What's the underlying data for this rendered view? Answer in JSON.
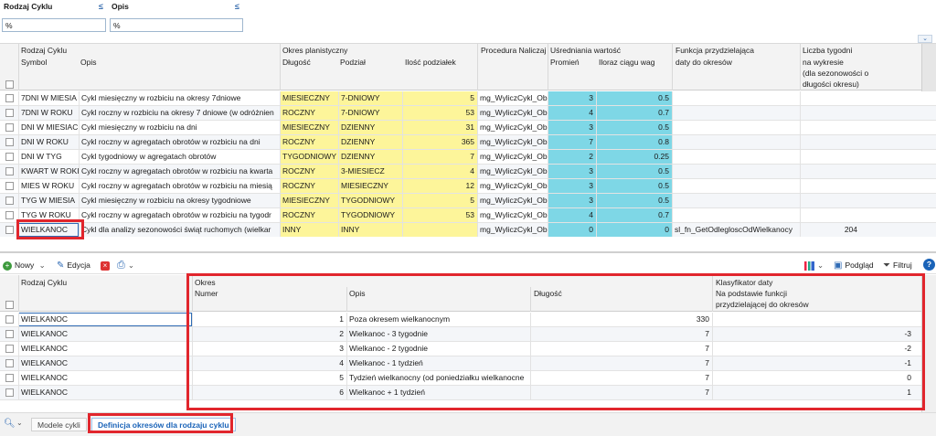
{
  "filters": {
    "rodzaj_label": "Rodzaj Cyklu",
    "opis_label": "Opis",
    "rodzaj_value": "%",
    "opis_value": "%"
  },
  "top_grid": {
    "group_headers": {
      "rodzaj": "Rodzaj Cyklu",
      "okres": "Okres planistyczny",
      "procedura": "Procedura Naliczaj",
      "usrednianie": "Uśredniania wartość",
      "funkcja": "Funkcja przydzielająca",
      "liczba": "Liczba tygodni"
    },
    "col_headers": {
      "symbol": "Symbol",
      "opis": "Opis",
      "dlugosc": "Długość",
      "podzial": "Podział",
      "ilosc": "Ilość podziałek",
      "promien": "Promień",
      "iloraz": "Iloraz ciągu wag",
      "funkcja2": "daty do okresów",
      "liczba2": "na wykresie",
      "liczba3": "(dla sezonowości o",
      "liczba4": "długości okresu)"
    },
    "rows": [
      {
        "symbol": "7DNI W MIESIA",
        "opis": "Cykl miesięczny w rozbiciu na okresy 7dniowe",
        "dlugosc": "MIESIECZNY",
        "podzial": "7-DNIOWY",
        "ilosc": "5",
        "procedura": "mg_WyliczCykl_Ob",
        "promien": "3",
        "iloraz": "0.5",
        "funkcja": "",
        "liczba": ""
      },
      {
        "symbol": "7DNI W ROKU",
        "opis": "Cykl roczny w rozbiciu na okresy 7 dniowe (w odróżnien",
        "dlugosc": "ROCZNY",
        "podzial": "7-DNIOWY",
        "ilosc": "53",
        "procedura": "mg_WyliczCykl_Ob",
        "promien": "4",
        "iloraz": "0.7",
        "funkcja": "",
        "liczba": ""
      },
      {
        "symbol": "DNI W MIESIAC",
        "opis": "Cykl miesięczny w rozbiciu na dni",
        "dlugosc": "MIESIECZNY",
        "podzial": "DZIENNY",
        "ilosc": "31",
        "procedura": "mg_WyliczCykl_Ob",
        "promien": "3",
        "iloraz": "0.5",
        "funkcja": "",
        "liczba": ""
      },
      {
        "symbol": "DNI W ROKU",
        "opis": "Cykl roczny w agregatach obrotów w rozbiciu na dni",
        "dlugosc": "ROCZNY",
        "podzial": "DZIENNY",
        "ilosc": "365",
        "procedura": "mg_WyliczCykl_Ob",
        "promien": "7",
        "iloraz": "0.8",
        "funkcja": "",
        "liczba": ""
      },
      {
        "symbol": "DNI W TYG",
        "opis": "Cykl tygodniowy w agregatach obrotów",
        "dlugosc": "TYGODNIOWY",
        "podzial": "DZIENNY",
        "ilosc": "7",
        "procedura": "mg_WyliczCykl_Ob",
        "promien": "2",
        "iloraz": "0.25",
        "funkcja": "",
        "liczba": ""
      },
      {
        "symbol": "KWART W ROKI",
        "opis": "Cykl roczny w agregatach obrotów w rozbiciu na kwarta",
        "dlugosc": "ROCZNY",
        "podzial": "3-MIESIECZ",
        "ilosc": "4",
        "procedura": "mg_WyliczCykl_Ob",
        "promien": "3",
        "iloraz": "0.5",
        "funkcja": "",
        "liczba": ""
      },
      {
        "symbol": "MIES W ROKU",
        "opis": "Cykl roczny w agregatach obrotów w rozbiciu na miesią",
        "dlugosc": "ROCZNY",
        "podzial": "MIESIECZNY",
        "ilosc": "12",
        "procedura": "mg_WyliczCykl_Ob",
        "promien": "3",
        "iloraz": "0.5",
        "funkcja": "",
        "liczba": ""
      },
      {
        "symbol": "TYG W MIESIA",
        "opis": "Cykl miesięczny w rozbiciu na okresy tygodniowe",
        "dlugosc": "MIESIECZNY",
        "podzial": "TYGODNIOWY",
        "ilosc": "5",
        "procedura": "mg_WyliczCykl_Ob",
        "promien": "3",
        "iloraz": "0.5",
        "funkcja": "",
        "liczba": ""
      },
      {
        "symbol": "TYG W ROKU",
        "opis": "Cykl roczny w agregatach obrotów w rozbiciu na tygodr",
        "dlugosc": "ROCZNY",
        "podzial": "TYGODNIOWY",
        "ilosc": "53",
        "procedura": "mg_WyliczCykl_Ob",
        "promien": "4",
        "iloraz": "0.7",
        "funkcja": "",
        "liczba": ""
      },
      {
        "symbol": "WIELKANOC",
        "opis": "Cykl dla analizy sezonowości świąt ruchomych (wielkar",
        "dlugosc": "INNY",
        "podzial": "INNY",
        "ilosc": "",
        "procedura": "mg_WyliczCykl_Ob",
        "promien": "0",
        "iloraz": "0",
        "funkcja": "sl_fn_GetOdlegloscOdWielkanocy",
        "liczba": "204"
      }
    ]
  },
  "toolbar": {
    "nowy": "Nowy",
    "edycja": "Edycja",
    "podglad": "Podgląd",
    "filtruj": "Filtruj"
  },
  "bottom_grid": {
    "headers": {
      "rodzaj": "Rodzaj Cyklu",
      "okres": "Okres",
      "numer": "Numer",
      "opis": "Opis",
      "dlugosc": "Długość",
      "klas1": "Klasyfikator daty",
      "klas2": "Na podstawie funkcji",
      "klas3": "przydzielającej do okresów"
    },
    "rows": [
      {
        "rodzaj": "WIELKANOC",
        "numer": "1",
        "opis": "Poza okresem wielkanocnym",
        "dlugosc": "330",
        "klas": ""
      },
      {
        "rodzaj": "WIELKANOC",
        "numer": "2",
        "opis": "Wielkanoc - 3 tygodnie",
        "dlugosc": "7",
        "klas": "-3"
      },
      {
        "rodzaj": "WIELKANOC",
        "numer": "3",
        "opis": "Wielkanoc - 2 tygodnie",
        "dlugosc": "7",
        "klas": "-2"
      },
      {
        "rodzaj": "WIELKANOC",
        "numer": "4",
        "opis": "Wielkanoc - 1 tydzień",
        "dlugosc": "7",
        "klas": "-1"
      },
      {
        "rodzaj": "WIELKANOC",
        "numer": "5",
        "opis": "Tydzień wielkanocny (od poniedziałku wielkanocne",
        "dlugosc": "7",
        "klas": "0"
      },
      {
        "rodzaj": "WIELKANOC",
        "numer": "6",
        "opis": "Wielkanoc + 1 tydzień",
        "dlugosc": "7",
        "klas": "1"
      }
    ]
  },
  "tabs": {
    "modele": "Modele cykli",
    "definicja": "Definicja okresów dla rodzaju cyklu"
  },
  "colors": {
    "highlight_red": "#e1262d",
    "yellow": "#fdf59a",
    "cyan": "#7ed7e6",
    "accent_blue": "#1a63b8"
  }
}
